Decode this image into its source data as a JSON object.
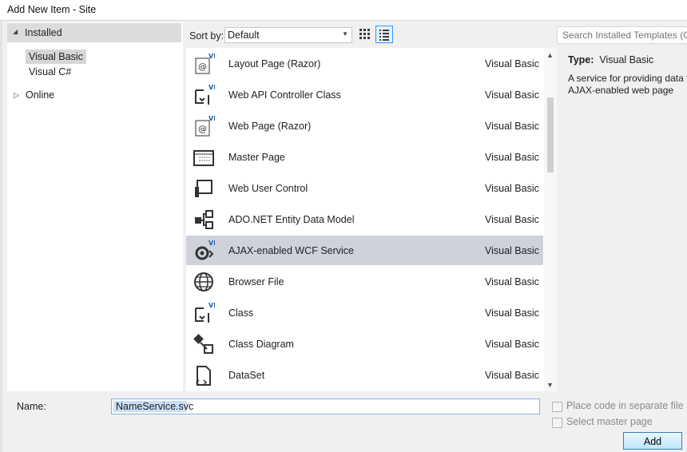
{
  "window": {
    "title": "Add New Item - Site"
  },
  "tree": {
    "installed_label": "Installed",
    "items": [
      {
        "label": "Visual Basic",
        "selected": true
      },
      {
        "label": "Visual C#",
        "selected": false
      }
    ],
    "online_label": "Online"
  },
  "toolbar": {
    "sort_label": "Sort by:",
    "sort_value": "Default",
    "view_buttons": [
      "medium-icons-view",
      "list-details-view"
    ],
    "search_placeholder": "Search Installed Templates (Ctrl+E)"
  },
  "templates": [
    {
      "name": "Layout Page (Razor)",
      "lang": "Visual Basic",
      "icon": "razor-page-icon",
      "selected": false
    },
    {
      "name": "Web API Controller Class",
      "lang": "Visual Basic",
      "icon": "controller-class-icon",
      "selected": false
    },
    {
      "name": "Web Page (Razor)",
      "lang": "Visual Basic",
      "icon": "razor-page-icon",
      "selected": false
    },
    {
      "name": "Master Page",
      "lang": "Visual Basic",
      "icon": "master-page-icon",
      "selected": false
    },
    {
      "name": "Web User Control",
      "lang": "Visual Basic",
      "icon": "user-control-icon",
      "selected": false
    },
    {
      "name": "ADO.NET Entity Data Model",
      "lang": "Visual Basic",
      "icon": "entity-model-icon",
      "selected": false
    },
    {
      "name": "AJAX-enabled WCF Service",
      "lang": "Visual Basic",
      "icon": "wcf-service-icon",
      "selected": true
    },
    {
      "name": "Browser File",
      "lang": "Visual Basic",
      "icon": "browser-file-icon",
      "selected": false
    },
    {
      "name": "Class",
      "lang": "Visual Basic",
      "icon": "class-icon",
      "selected": false
    },
    {
      "name": "Class Diagram",
      "lang": "Visual Basic",
      "icon": "class-diagram-icon",
      "selected": false
    },
    {
      "name": "DataSet",
      "lang": "Visual Basic",
      "icon": "dataset-icon",
      "selected": false
    }
  ],
  "details": {
    "type_label": "Type:",
    "type_value": "Visual Basic",
    "description": "A service for providing data to an AJAX-enabled web page"
  },
  "name_field": {
    "label": "Name:",
    "value": "NameService.svc"
  },
  "options": {
    "place_code_label": "Place code in separate file",
    "select_master_label": "Select master page"
  },
  "buttons": {
    "add_label": "Add"
  },
  "colors": {
    "selection": "#cfd2db",
    "accent": "#3399ff",
    "vb_badge": "#1f5fa8"
  }
}
